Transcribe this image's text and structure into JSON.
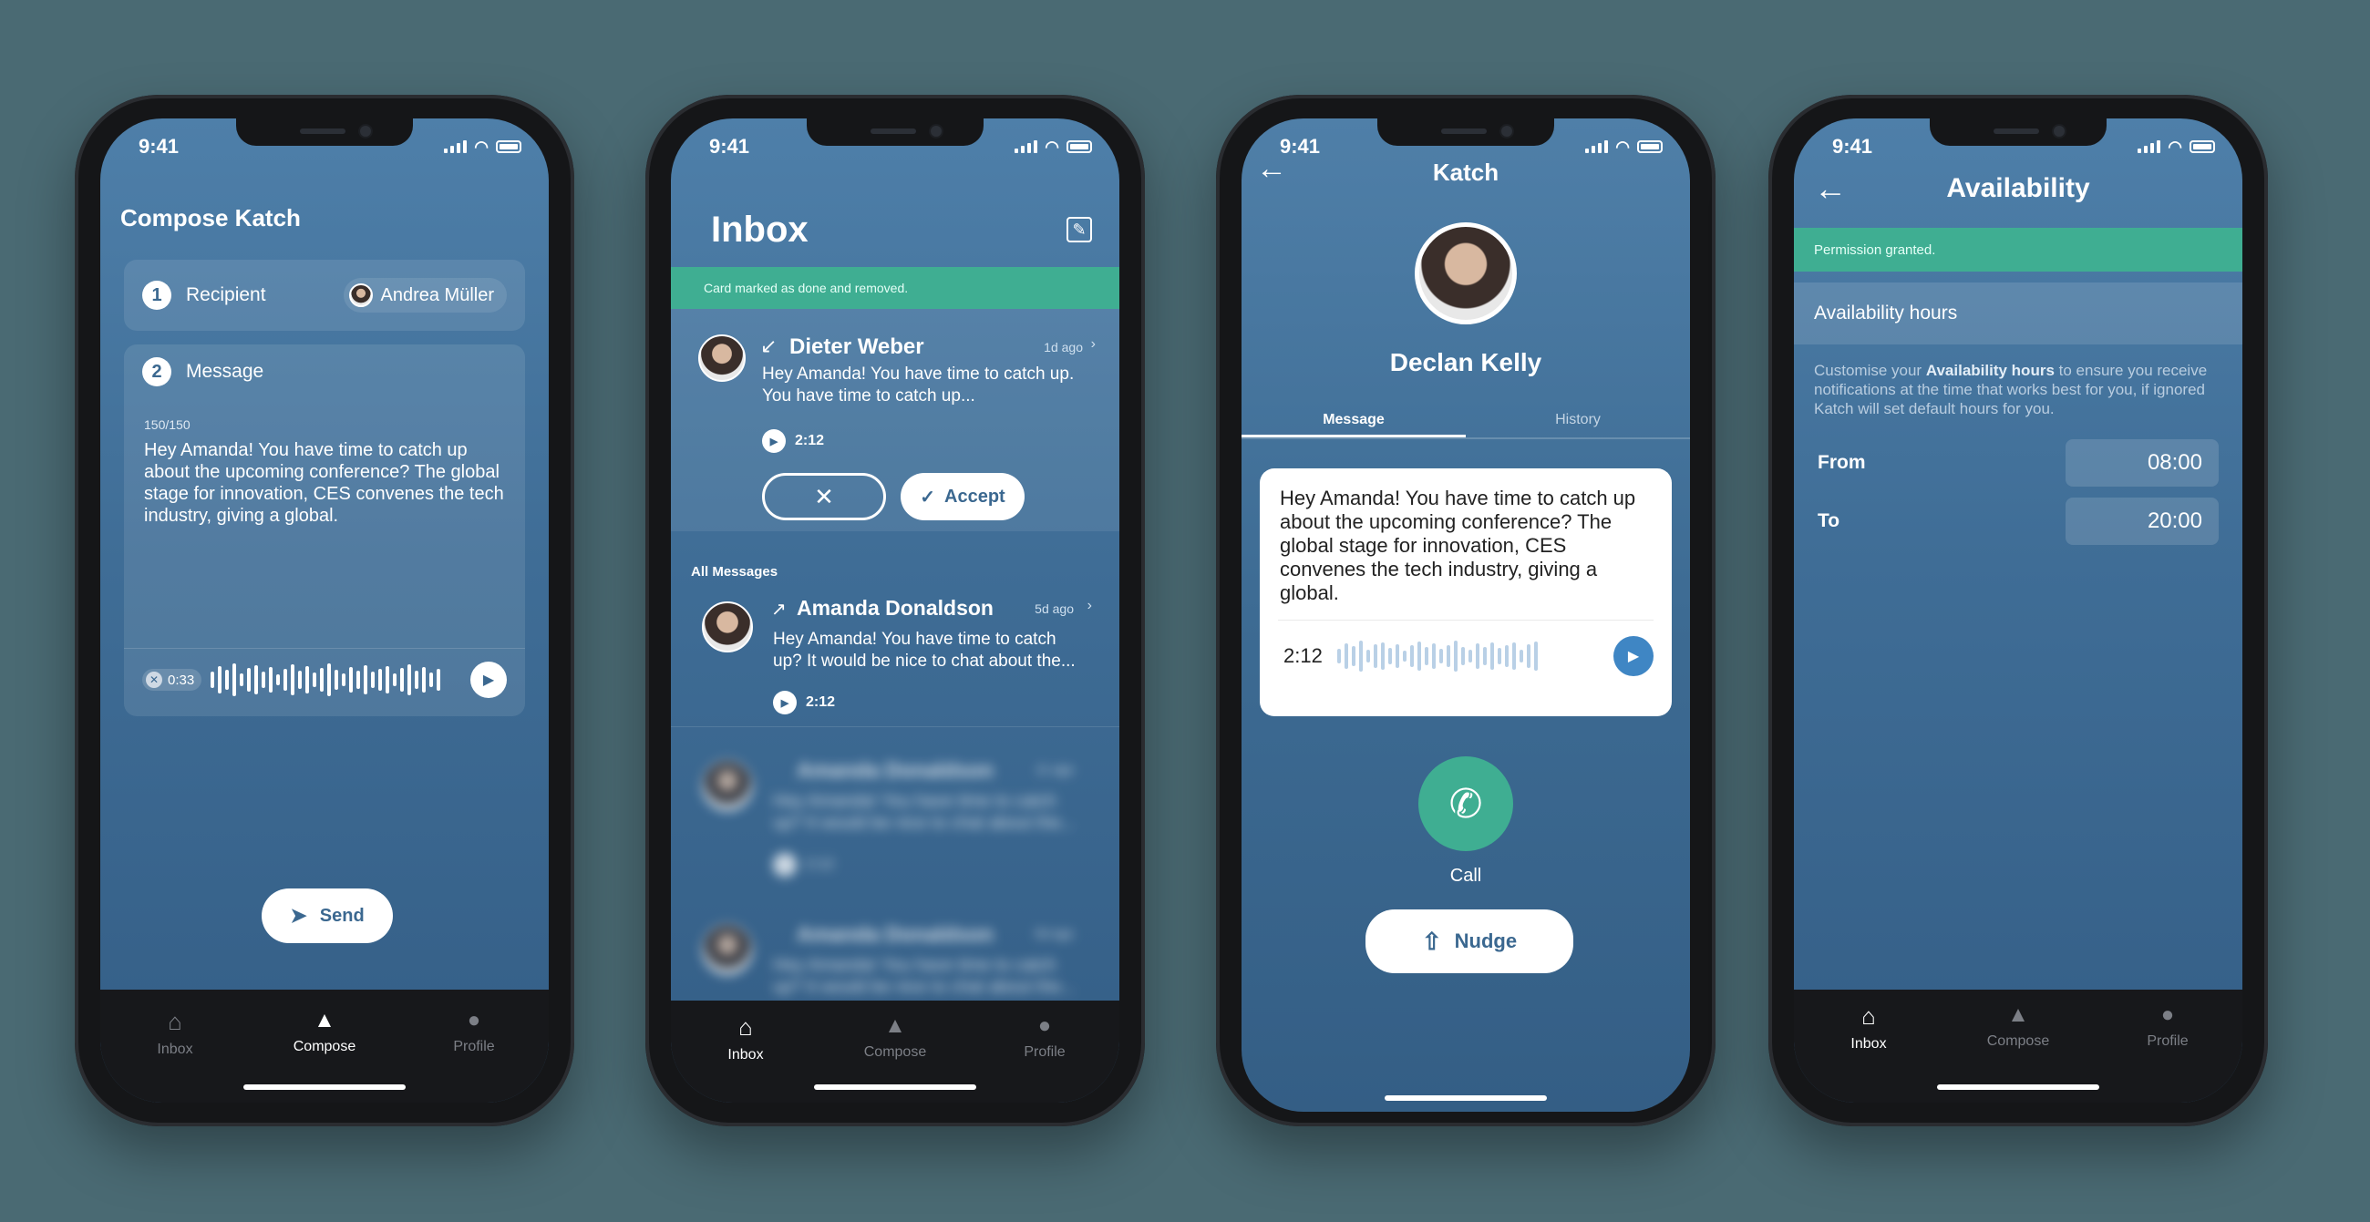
{
  "status_time": "9:41",
  "tabs": {
    "inbox": "Inbox",
    "compose": "Compose",
    "profile": "Profile"
  },
  "compose": {
    "title": "Compose Katch",
    "recipient_step": "1",
    "recipient_label": "Recipient",
    "recipient_name": "Andrea Müller",
    "message_step": "2",
    "message_label": "Message",
    "char_count": "150/150",
    "message_text": "Hey Amanda! You have time to catch up about the upcoming conference? The global stage for innovation, CES convenes the tech industry, giving a global.",
    "audio_duration": "0:33",
    "send_label": "Send"
  },
  "inbox": {
    "title": "Inbox",
    "banner": "Card marked as done and removed.",
    "pending": {
      "name": "Dieter Weber",
      "time": "1d ago",
      "preview": "Hey Amanda! You have time to catch up. You have time to catch up...",
      "duration": "2:12"
    },
    "accept_label": "Accept",
    "section_label": "All Messages",
    "messages": [
      {
        "name": "Amanda Donaldson",
        "time": "5d ago",
        "preview": "Hey Amanda! You have time to catch up? It would be nice to chat about the...",
        "duration": "2:12"
      },
      {
        "name": "Amanda Donaldson",
        "time": "11 ago",
        "preview": "Hey Amanda! You have time to catch up? It would be nice to chat about the...",
        "duration": "2:12"
      },
      {
        "name": "Amanda Donaldson",
        "time": "5d ago",
        "preview": "Hey Amanda! You have time to catch up? It would be nice to chat about the..."
      }
    ]
  },
  "katch": {
    "title": "Katch",
    "contact_name": "Declan Kelly",
    "tab_message": "Message",
    "tab_history": "History",
    "message_text": "Hey Amanda! You have time to catch up about the upcoming conference? The global stage for innovation, CES convenes the tech industry, giving a global.",
    "audio_duration": "2:12",
    "call_label": "Call",
    "nudge_label": "Nudge"
  },
  "availability": {
    "title": "Availability",
    "banner": "Permission granted.",
    "section_label": "Availability hours",
    "desc_pre": "Customise your ",
    "desc_bold": "Availability hours",
    "desc_post": " to ensure you receive notifications at the time that works best for you, if ignored Katch will set default hours for you.",
    "from_label": "From",
    "from_value": "08:00",
    "to_label": "To",
    "to_value": "20:00"
  },
  "colors": {
    "accent_green": "#3fae92",
    "screen_blue": "#4a7aa3",
    "play_blue": "#3f86c4"
  }
}
